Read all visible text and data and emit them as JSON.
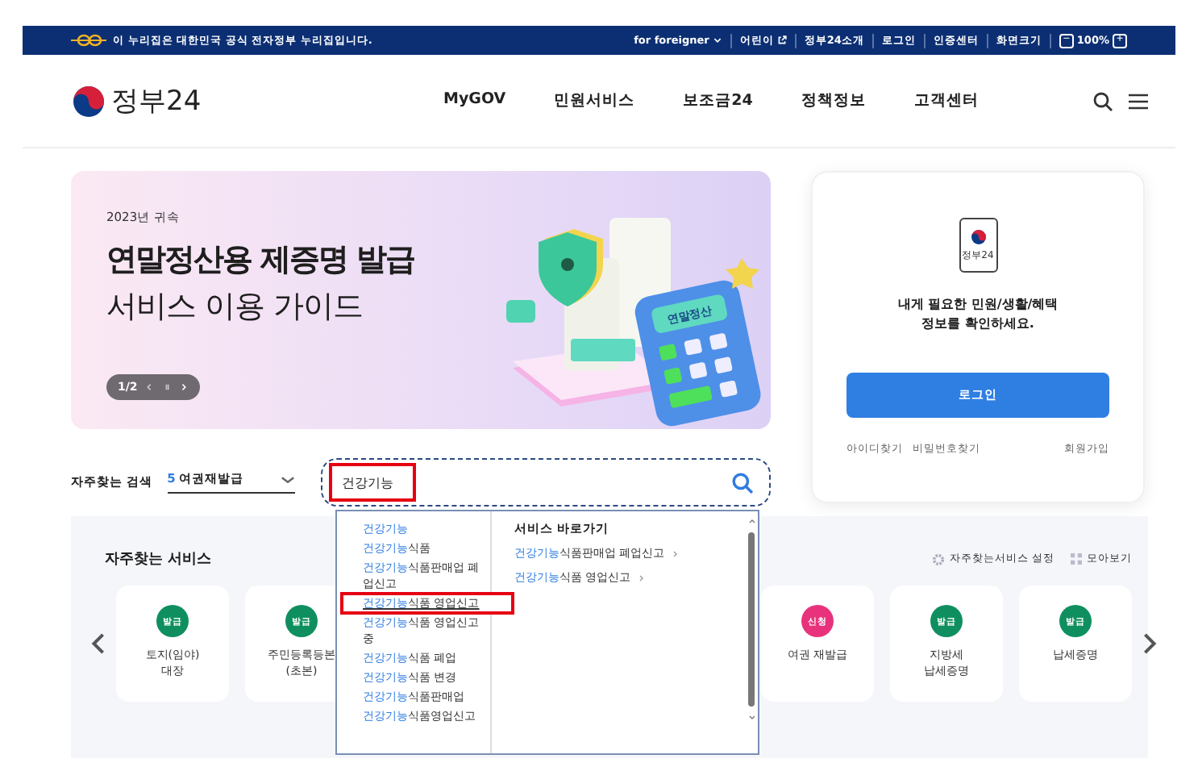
{
  "top_bar": {
    "notice": "이 누리집은 대한민국 공식 전자정부 누리집입니다.",
    "links": [
      {
        "label": "for foreigner",
        "kind": "dropdown"
      },
      {
        "label": "어린이",
        "kind": "external"
      },
      {
        "label": "정부24소개",
        "kind": "plain"
      },
      {
        "label": "로그인",
        "kind": "plain"
      },
      {
        "label": "인증센터",
        "kind": "plain"
      },
      {
        "label": "화면크기",
        "kind": "plain"
      }
    ],
    "zoom": {
      "minus": "−",
      "value": "100%",
      "plus": "+"
    }
  },
  "header": {
    "logo": "정부24",
    "nav": [
      "MyGOV",
      "민원서비스",
      "보조금24",
      "정책정보",
      "고객센터"
    ]
  },
  "banner": {
    "eyebrow": "2023년 귀속",
    "title": "연말정산용 제증명 발급",
    "subtitle": "서비스 이용 가이드",
    "pager": "1/2",
    "illustration_label": "연말정산"
  },
  "login_card": {
    "phone_label": "정부24",
    "message": [
      "내게 필요한 민원/생활/혜택",
      "정보를 확인하세요."
    ],
    "button": "로그인",
    "links": [
      "아이디찾기",
      "비밀번호찾기"
    ],
    "signup": "회원가입"
  },
  "frequent_search": {
    "label": "자주찾는 검색",
    "rank": "5",
    "value": "여권재발급"
  },
  "search": {
    "value": "건강기능",
    "highlighted": true
  },
  "suggestions": {
    "items": [
      {
        "match": "건강기능",
        "highlighted": false
      },
      {
        "match": "건강기능",
        "rest": "식품",
        "highlighted": false
      },
      {
        "match": "건강기능",
        "rest": "식품판매업 폐업신고",
        "highlighted": false
      },
      {
        "match": "건강기능",
        "rest": "식품 영업신고",
        "highlighted": true
      },
      {
        "match": "건강기능",
        "rest": "식품 영업신고 중",
        "highlighted": false
      },
      {
        "match": "건강기능",
        "rest": "식품 폐업",
        "highlighted": false
      },
      {
        "match": "건강기능",
        "rest": "식품 변경",
        "highlighted": false
      },
      {
        "match": "건강기능",
        "rest": "식품판매업",
        "highlighted": false
      },
      {
        "match": "건강기능",
        "rest": "식품영업신고",
        "highlighted": false
      }
    ],
    "shortcuts_title": "서비스 바로가기",
    "shortcuts": [
      {
        "match": "건강기능",
        "rest": "식품판매업 폐업신고"
      },
      {
        "match": "건강기능",
        "rest": "식품 영업신고"
      }
    ]
  },
  "services": {
    "title": "자주찾는 서비스",
    "settings": "자주찾는서비스 설정",
    "view_all": "모아보기",
    "cards": [
      {
        "badge": "발급",
        "kind": "issue",
        "name": [
          "토지(임야)",
          "대장"
        ]
      },
      {
        "badge": "발급",
        "kind": "issue",
        "name": [
          "주민등록등본",
          "(초본)"
        ]
      },
      {
        "badge": "신청",
        "kind": "apply",
        "name": [
          "여권 재발급"
        ]
      },
      {
        "badge": "발급",
        "kind": "issue",
        "name": [
          "지방세",
          "납세증명"
        ]
      },
      {
        "badge": "발급",
        "kind": "issue",
        "name": [
          "납세증명"
        ]
      }
    ]
  }
}
